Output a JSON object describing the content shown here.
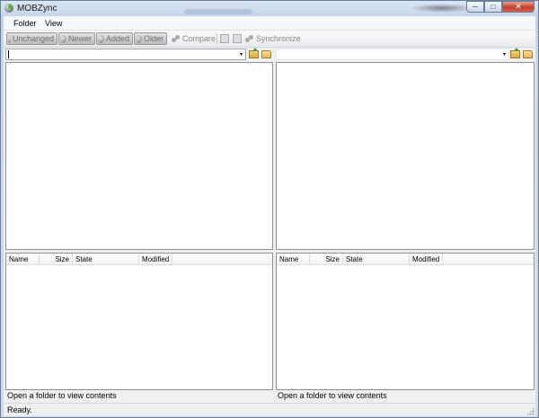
{
  "window": {
    "title": "MOBZync",
    "buttons": {
      "minimize": "─",
      "maximize": "□",
      "close": "✕"
    }
  },
  "menu": [
    "Folder",
    "View"
  ],
  "toolbar": {
    "filters": [
      "Unchanged",
      "Newer",
      "Added",
      "Older"
    ],
    "compare_label": "Compare",
    "synchronize_label": "Synchronize"
  },
  "left": {
    "path_value": "",
    "columns": [
      "Name",
      "Size",
      "State",
      "Modified"
    ],
    "status": "Open a folder to view contents"
  },
  "right": {
    "path_value": "",
    "columns": [
      "Name",
      "Size",
      "State",
      "Modified"
    ],
    "status": "Open a folder to view contents"
  },
  "statusbar": {
    "text": "Ready."
  },
  "icons": {
    "combo_arrow": "▾",
    "up_folder": "folder-up-icon",
    "open_folder": "folder-open-icon"
  },
  "colors": {
    "accent": "#3a9c35",
    "close": "#c2402b"
  }
}
